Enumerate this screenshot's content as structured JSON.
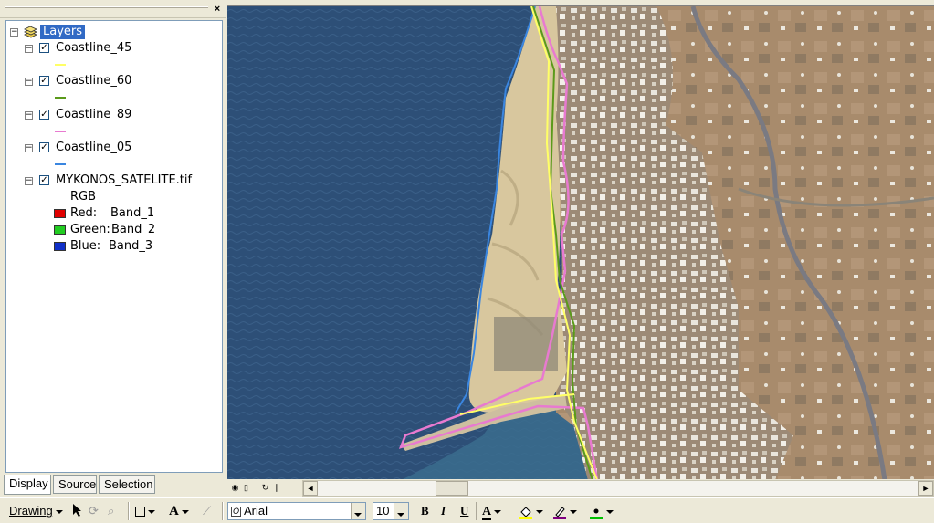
{
  "toc": {
    "close_glyph": "×",
    "root_label": "Layers",
    "layers": [
      {
        "name": "Coastline_45",
        "checked": true,
        "color": "#ffff66"
      },
      {
        "name": "Coastline_60",
        "checked": true,
        "color": "#5a9a1a"
      },
      {
        "name": "Coastline_89",
        "checked": true,
        "color": "#e87ad0"
      },
      {
        "name": "Coastline_05",
        "checked": true,
        "color": "#3a86e0"
      }
    ],
    "raster": {
      "name": "MYKONOS_SATELITE.tif",
      "checked": true,
      "renderer": "RGB",
      "bands": [
        {
          "label": "Red:",
          "band": "Band_1",
          "color": "#e00000"
        },
        {
          "label": "Green:",
          "band": "Band_2",
          "color": "#22cc22"
        },
        {
          "label": "Blue:",
          "band": "Band_3",
          "color": "#1030c8"
        }
      ]
    },
    "expander_glyph": "−",
    "check_glyph": "✓",
    "tabs": [
      "Display",
      "Source",
      "Selection"
    ]
  },
  "map": {
    "sea_color": "#2d4f77",
    "beach_color": "#d8c79e",
    "land_color": "#a58a6f"
  },
  "statusbar": {
    "left_arrow": "◄",
    "right_arrow": "►"
  },
  "drawing_toolbar": {
    "drawing_label": "Drawing",
    "font_name": "Arial",
    "font_size": "10",
    "bold": "B",
    "italic": "I",
    "underline": "U",
    "text_color_label": "A",
    "font_color": "#000000",
    "fill_color": "#ffff00",
    "line_color": "#800080",
    "marker_color": "#00c000"
  }
}
